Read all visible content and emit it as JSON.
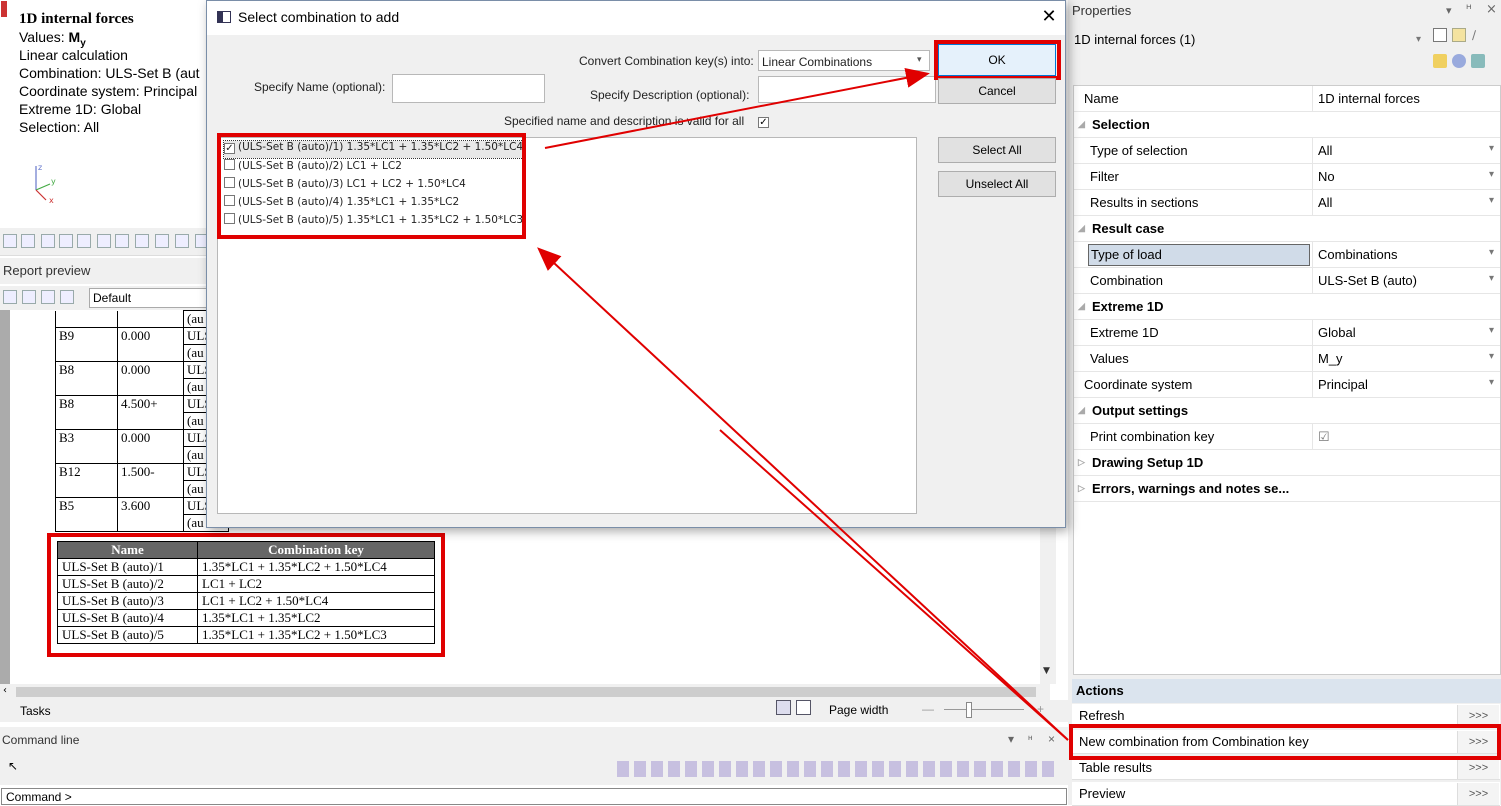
{
  "info": {
    "title": "1D internal forces",
    "values_prefix": "Values: ",
    "values_main": "M",
    "values_sub": "y",
    "calc": "Linear calculation",
    "combination": "Combination: ULS-Set B (aut",
    "coord": "Coordinate system: Principal",
    "extreme": "Extreme 1D: Global",
    "selection": "Selection: All",
    "axis_z": "z",
    "axis_y": "y",
    "axis_x": "x"
  },
  "report_preview": {
    "title": "Report preview",
    "template": "Default"
  },
  "report_table": {
    "rows": [
      {
        "member": "",
        "x": "",
        "case": "(au"
      },
      {
        "member": "B9",
        "x": "0.000",
        "case": "ULS"
      },
      {
        "member": "",
        "x": "",
        "case": "(au"
      },
      {
        "member": "B8",
        "x": "0.000",
        "case": "ULS"
      },
      {
        "member": "",
        "x": "",
        "case": "(au"
      },
      {
        "member": "B8",
        "x": "4.500+",
        "case": "ULS"
      },
      {
        "member": "",
        "x": "",
        "case": "(au"
      },
      {
        "member": "B3",
        "x": "0.000",
        "case": "ULS"
      },
      {
        "member": "",
        "x": "",
        "case": "(au"
      },
      {
        "member": "B12",
        "x": "1.500-",
        "case": "ULS"
      },
      {
        "member": "",
        "x": "",
        "case": "(au"
      },
      {
        "member": "B5",
        "x": "3.600",
        "case": "ULS"
      },
      {
        "member": "",
        "x": "",
        "case": "(au"
      }
    ]
  },
  "combination_table": {
    "headers": [
      "Name",
      "Combination key"
    ],
    "rows": [
      [
        "ULS-Set  B (auto)/1",
        "1.35*LC1  + 1.35*LC2  + 1.50*LC4"
      ],
      [
        "ULS-Set  B (auto)/2",
        "LC1  + LC2"
      ],
      [
        "ULS-Set  B (auto)/3",
        "LC1  + LC2  + 1.50*LC4"
      ],
      [
        "ULS-Set  B (auto)/4",
        "1.35*LC1  + 1.35*LC2"
      ],
      [
        "ULS-Set  B (auto)/5",
        "1.35*LC1  + 1.35*LC2  + 1.50*LC3"
      ]
    ]
  },
  "tasks": {
    "label": "Tasks",
    "page_width": "Page width",
    "zoom_minus": "—",
    "zoom_plus": "+"
  },
  "command_line": {
    "title": "Command line",
    "prompt": "Command >",
    "pin": "↓ ! ×"
  },
  "dialog": {
    "title": "Select combination to add",
    "close": "✕",
    "convert_label": "Convert Combination key(s) into:",
    "convert_value": "Linear Combinations",
    "name_label": "Specify Name (optional):",
    "name_value": "",
    "desc_label": "Specify Description (optional):",
    "desc_value": "",
    "valid_label": "Specified name and description is valid for all",
    "ok": "OK",
    "cancel": "Cancel",
    "select_all": "Select All",
    "unselect_all": "Unselect All",
    "items": [
      {
        "label": "(ULS-Set B (auto)/1) 1.35*LC1 + 1.35*LC2 + 1.50*LC4",
        "checked": true
      },
      {
        "label": "(ULS-Set B (auto)/2) LC1 + LC2",
        "checked": false
      },
      {
        "label": "(ULS-Set B (auto)/3) LC1 + LC2 + 1.50*LC4",
        "checked": false
      },
      {
        "label": "(ULS-Set B (auto)/4) 1.35*LC1 + 1.35*LC2",
        "checked": false
      },
      {
        "label": "(ULS-Set B (auto)/5) 1.35*LC1 + 1.35*LC2 + 1.50*LC3",
        "checked": false
      }
    ]
  },
  "properties": {
    "title": "Properties",
    "object": "1D internal forces (1)",
    "rows": [
      {
        "type": "field",
        "key": "Name",
        "value": "1D internal forces",
        "dd": false
      },
      {
        "type": "cat",
        "key": "Selection"
      },
      {
        "type": "field",
        "key": "Type of selection",
        "value": "All",
        "dd": true
      },
      {
        "type": "field",
        "key": "Filter",
        "value": "No",
        "dd": true
      },
      {
        "type": "field",
        "key": "Results in sections",
        "value": "All",
        "dd": true
      },
      {
        "type": "cat",
        "key": "Result case"
      },
      {
        "type": "field",
        "key": "Type of load",
        "value": "Combinations",
        "dd": true,
        "selected": true
      },
      {
        "type": "field",
        "key": "Combination",
        "value": "ULS-Set B (auto)",
        "dd": true
      },
      {
        "type": "cat",
        "key": "Extreme 1D"
      },
      {
        "type": "field",
        "key": "Extreme 1D",
        "value": "Global",
        "dd": true
      },
      {
        "type": "field",
        "key": "Values",
        "value": "M_y",
        "dd": true
      },
      {
        "type": "field",
        "key": "Coordinate system",
        "value": "Principal",
        "dd": true
      },
      {
        "type": "cat",
        "key": "Output settings"
      },
      {
        "type": "field",
        "key": "Print combination key",
        "value": "☑",
        "dd": false
      },
      {
        "type": "cat",
        "key": "Drawing Setup 1D",
        "collapsed": true
      },
      {
        "type": "cat",
        "key": "Errors, warnings and notes se...",
        "collapsed": true
      }
    ]
  },
  "actions": {
    "title": "Actions",
    "items": [
      {
        "label": "Refresh",
        "button": ">>>"
      },
      {
        "label": "New combination from Combination key",
        "button": ">>>"
      },
      {
        "label": "Table results",
        "button": ">>>"
      },
      {
        "label": "Preview",
        "button": ">>>"
      }
    ]
  },
  "colors": {
    "highlight": "#e00000",
    "selected_cell": "#d0dbe8",
    "table_header": "#666666"
  }
}
